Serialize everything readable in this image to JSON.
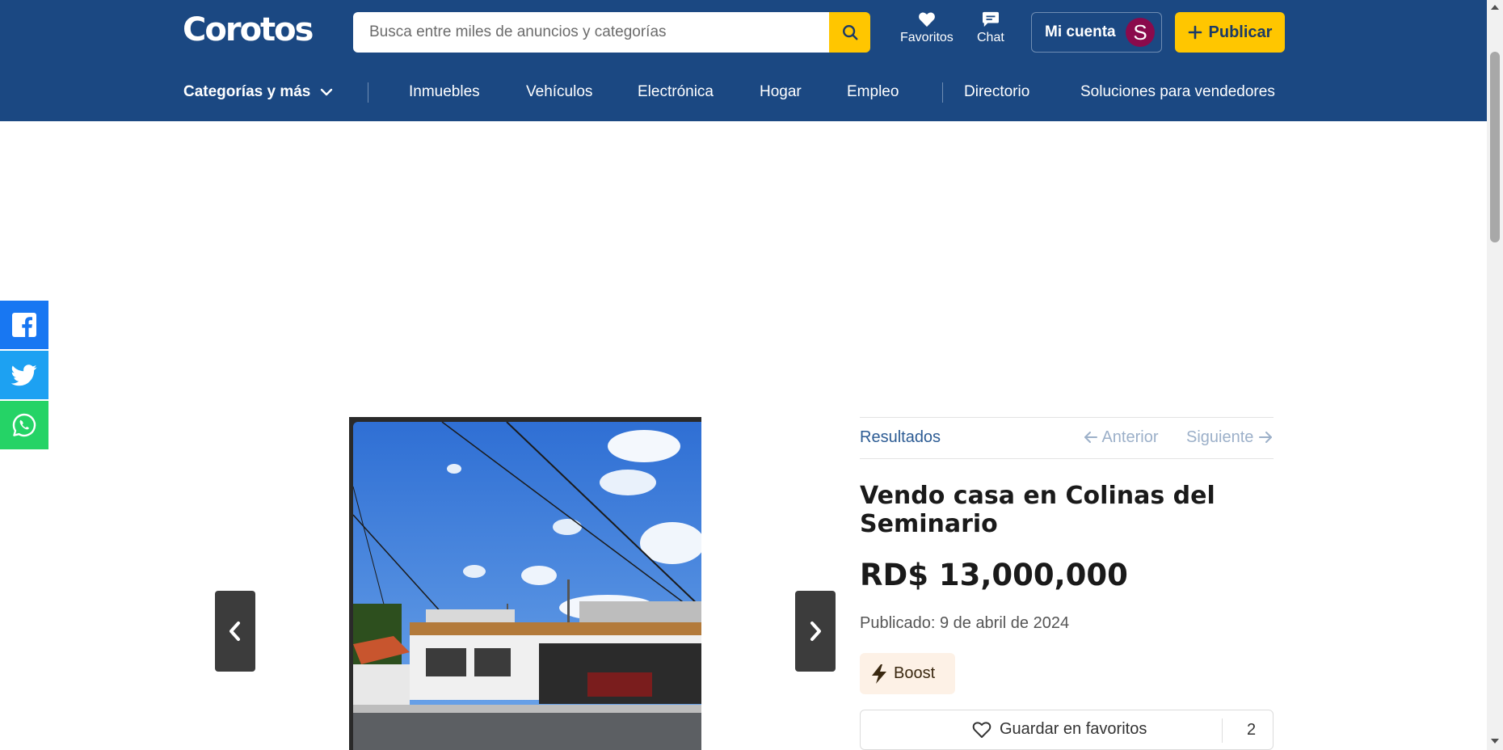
{
  "header": {
    "logo": "Corotos",
    "search": {
      "placeholder": "Busca entre miles de anuncios y categorías",
      "value": ""
    },
    "favorites_label": "Favoritos",
    "chat_label": "Chat",
    "account_label": "Mi cuenta",
    "avatar_letter": "S",
    "publish_label": "Publicar"
  },
  "nav": {
    "categories_label": "Categorías y más",
    "items": [
      "Inmuebles",
      "Vehículos",
      "Electrónica",
      "Hogar",
      "Empleo"
    ],
    "directory_label": "Directorio",
    "sellers_label": "Soluciones para vendedores"
  },
  "share": {
    "facebook": "facebook-icon",
    "twitter": "twitter-icon",
    "whatsapp": "whatsapp-icon"
  },
  "listing": {
    "results_label": "Resultados",
    "previous_label": "Anterior",
    "next_label": "Siguiente",
    "title": "Vendo casa en Colinas del Seminario",
    "price": "RD$ 13,000,000",
    "published": "Publicado: 9 de abril de 2024",
    "boost_label": "Boost",
    "favorite_label": "Guardar en favoritos",
    "favorite_count": "2"
  },
  "colors": {
    "brand_blue": "#1b4882",
    "accent_yellow": "#ffc600",
    "facebook": "#1877f2",
    "twitter": "#1da1f2",
    "whatsapp": "#25d366",
    "avatar": "#8a0a4c"
  }
}
